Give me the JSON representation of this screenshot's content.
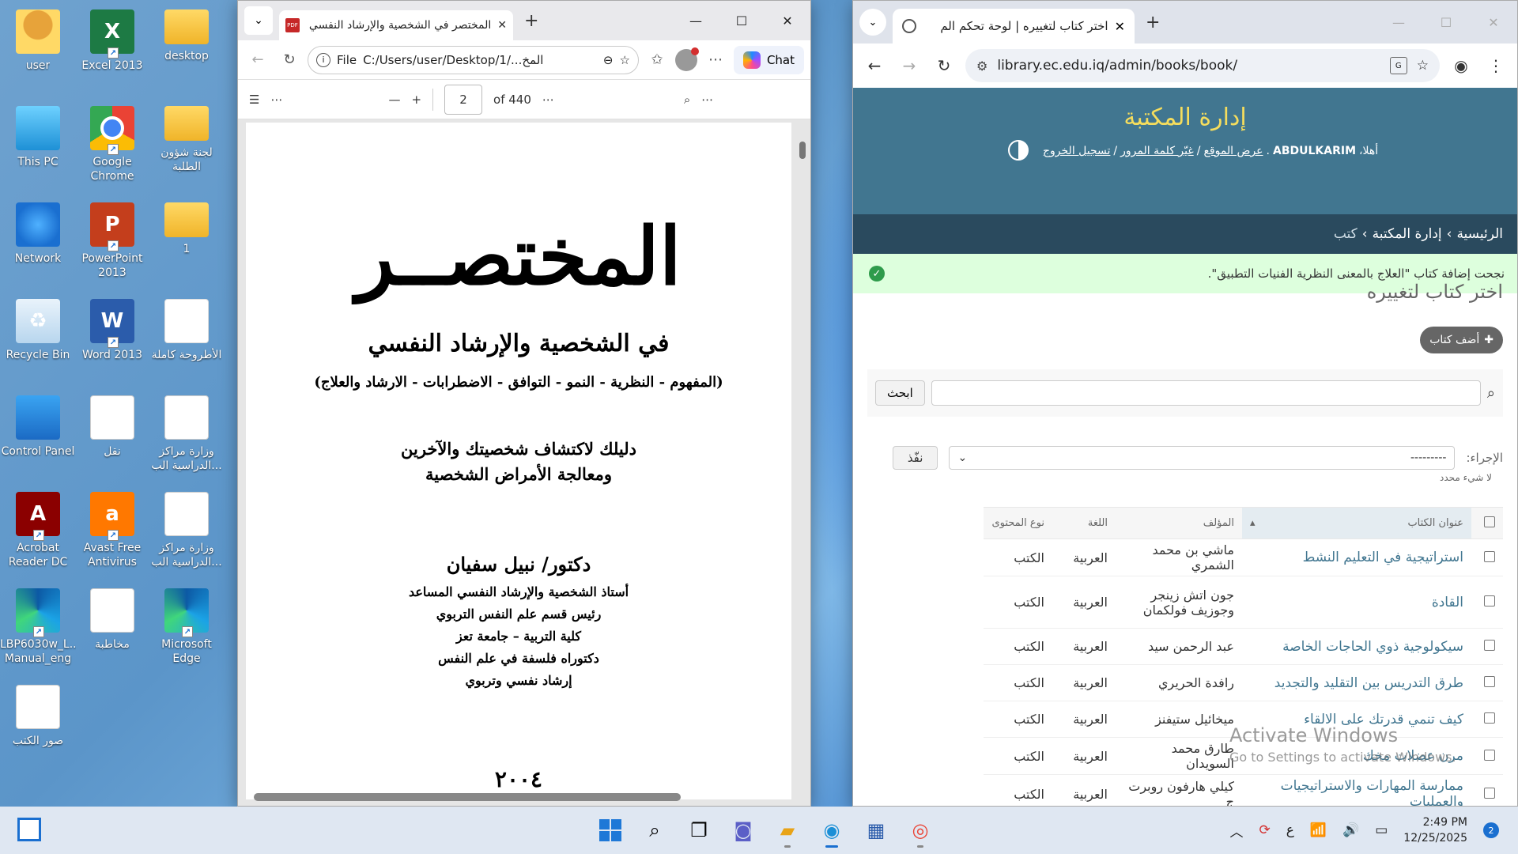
{
  "desktop": {
    "icons": [
      {
        "label": "user",
        "icon": "user-folder-icon"
      },
      {
        "label": "Excel 2013",
        "icon": "excel-icon"
      },
      {
        "label": "desktop",
        "icon": "folder-icon"
      },
      {
        "label": "This PC",
        "icon": "computer-icon"
      },
      {
        "label": "Google Chrome",
        "icon": "chrome-icon"
      },
      {
        "label": "لجنة شؤون الطلبة",
        "icon": "folder-icon"
      },
      {
        "label": "Network",
        "icon": "network-icon"
      },
      {
        "label": "PowerPoint 2013",
        "icon": "powerpoint-icon"
      },
      {
        "label": "1",
        "icon": "folder-icon"
      },
      {
        "label": "Recycle Bin",
        "icon": "recycle-bin-icon"
      },
      {
        "label": "Word 2013",
        "icon": "word-icon"
      },
      {
        "label": "الأطروحة كاملة",
        "icon": "pdf-icon"
      },
      {
        "label": "Control Panel",
        "icon": "control-panel-icon"
      },
      {
        "label": "نقل",
        "icon": "word-doc-icon"
      },
      {
        "label": "وزارة مراكز الدراسية الب...",
        "icon": "word-doc-icon"
      },
      {
        "label": "Acrobat Reader DC",
        "icon": "acrobat-icon"
      },
      {
        "label": "Avast Free Antivirus",
        "icon": "avast-icon"
      },
      {
        "label": "وزارة مراكز الدراسية الب...",
        "icon": "word-doc-icon"
      },
      {
        "label": "LBP6030w_L... Manual_eng",
        "icon": "edge-icon"
      },
      {
        "label": "مخاطبة",
        "icon": "word-doc-icon"
      },
      {
        "label": "Microsoft Edge",
        "icon": "edge-icon"
      },
      {
        "label": "صور الكتب",
        "icon": "word-doc-icon"
      }
    ]
  },
  "edge": {
    "tab_title": "المختصر في الشخصية والإرشاد النفسي",
    "address_prefix": "File",
    "address": "C:/Users/user/Desktop/1/...المخ",
    "chat_label": "Chat",
    "page_number": "2",
    "page_total": "of 440",
    "pdf": {
      "title": "المختصــر",
      "subtitle": "في الشخصية والإرشاد النفسي",
      "topics": "(المفهوم - النظرية - النمو - التوافق - الاضطرابات - الارشاد والعلاج)",
      "guide_line1": "دليلك لاكتشاف شخصيتك والآخرين",
      "guide_line2": "ومعالجة الأمراض الشخصية",
      "author": "دكتور/ نبيل سفيان",
      "credentials": [
        "أستاذ الشخصية والإرشاد النفسي المساعد",
        "رئيس قسم علم النفس التربوي",
        "كلية التربية – جامعة تعز",
        "دكتوراه فلسفة في علم النفس",
        "إرشاد نفسي وتربوي"
      ],
      "year": "٢٠٠٤"
    }
  },
  "chrome": {
    "tab_title": "اختر كتاب لتغييره | لوحة تحكم الم",
    "url": "library.ec.edu.iq/admin/books/book/",
    "site_name": "إدارة المكتبة",
    "user_tools": {
      "welcome": "أهلا،",
      "username": "ABDULKARIM",
      "view_site": "عرض الموقع",
      "change_password": "غيّر كلمة المرور",
      "logout": "تسجيل الخروج"
    },
    "breadcrumbs": {
      "home": "الرئيسية",
      "app": "إدارة المكتبة",
      "model": "كتب"
    },
    "success_message": "نجحت إضافة كتاب \"العلاج بالمعنى النظرية الفنيات التطبيق\".",
    "page_title": "اختر كتاب لتغييره",
    "add_button": "أضف كتاب",
    "search_button": "ابحث",
    "action_label": "الإجراء:",
    "action_placeholder": "---------",
    "go_button": "نفّذ",
    "selected_count": "لا شيء محدد",
    "columns": [
      "عنوان الكتاب",
      "المؤلف",
      "اللغة",
      "نوع المحتوى"
    ],
    "rows": [
      {
        "title": "استراتيجية في التعليم النشط",
        "author": "ماشي بن محمد الشمري",
        "language": "العربية",
        "type": "الكتب"
      },
      {
        "title": "القادة",
        "author": "جون اتش زينجر وجوزيف فولكمان",
        "language": "العربية",
        "type": "الكتب"
      },
      {
        "title": "سيكولوجية ذوي الحاجات الخاصة",
        "author": "عبد الرحمن سيد",
        "language": "العربية",
        "type": "الكتب"
      },
      {
        "title": "طرق التدريس بين التقليد والتجديد",
        "author": "رافدة الحريري",
        "language": "العربية",
        "type": "الكتب"
      },
      {
        "title": "كيف تنمي قدرتك على الالقاء",
        "author": "ميخائيل ستيفنز",
        "language": "العربية",
        "type": "الكتب"
      },
      {
        "title": "مرن عضلات مخك",
        "author": "طارق محمد السويدان",
        "language": "العربية",
        "type": "الكتب"
      },
      {
        "title": "ممارسة المهارات والاستراتيجيات والعمليات",
        "author": "كيلي هارفون روبرت ج",
        "language": "العربية",
        "type": "الكتب"
      }
    ]
  },
  "watermark": {
    "line1": "Activate Windows",
    "line2": "Go to Settings to activate Windows."
  },
  "taskbar": {
    "ime": "ع",
    "time": "2:49 PM",
    "date": "12/25/2025",
    "notifications": "2"
  }
}
